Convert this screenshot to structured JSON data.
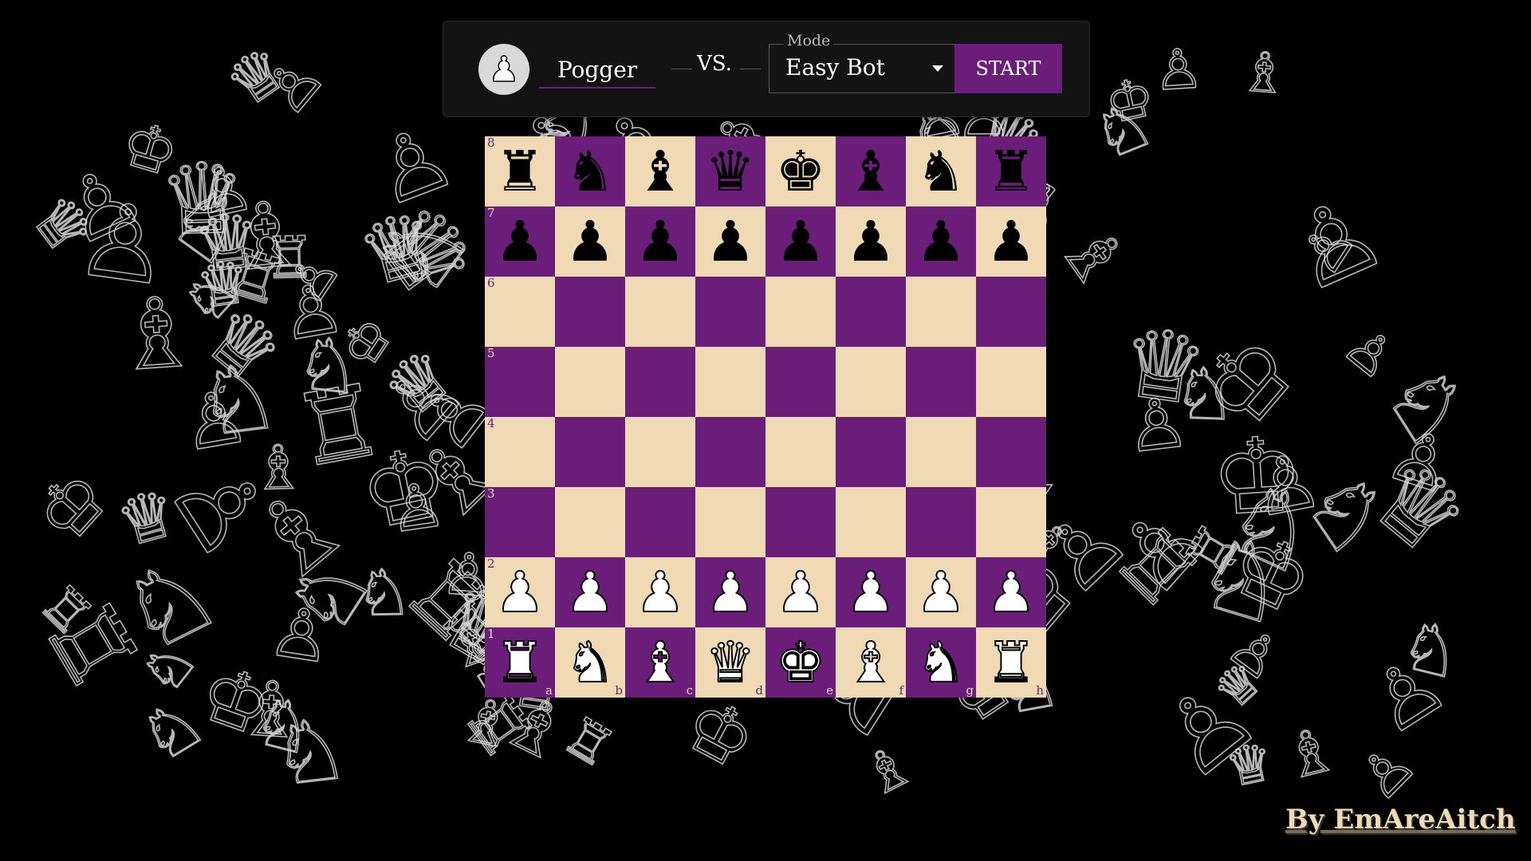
{
  "header": {
    "avatar_icon": "pawn-icon",
    "player_name": "Pogger",
    "vs_label": "VS.",
    "mode": {
      "label": "Mode",
      "selected": "Easy Bot"
    },
    "start_label": "START"
  },
  "board": {
    "colors": {
      "light": "#f0d9b5",
      "dark": "#6b1d7a"
    },
    "ranks": [
      "8",
      "7",
      "6",
      "5",
      "4",
      "3",
      "2",
      "1"
    ],
    "files": [
      "a",
      "b",
      "c",
      "d",
      "e",
      "f",
      "g",
      "h"
    ],
    "position": [
      "rnbqkbnr",
      "pppppppp",
      "........",
      "........",
      "........",
      "........",
      "PPPPPPPP",
      "RNBQKBNR"
    ]
  },
  "credit": "By EmAreAitch"
}
